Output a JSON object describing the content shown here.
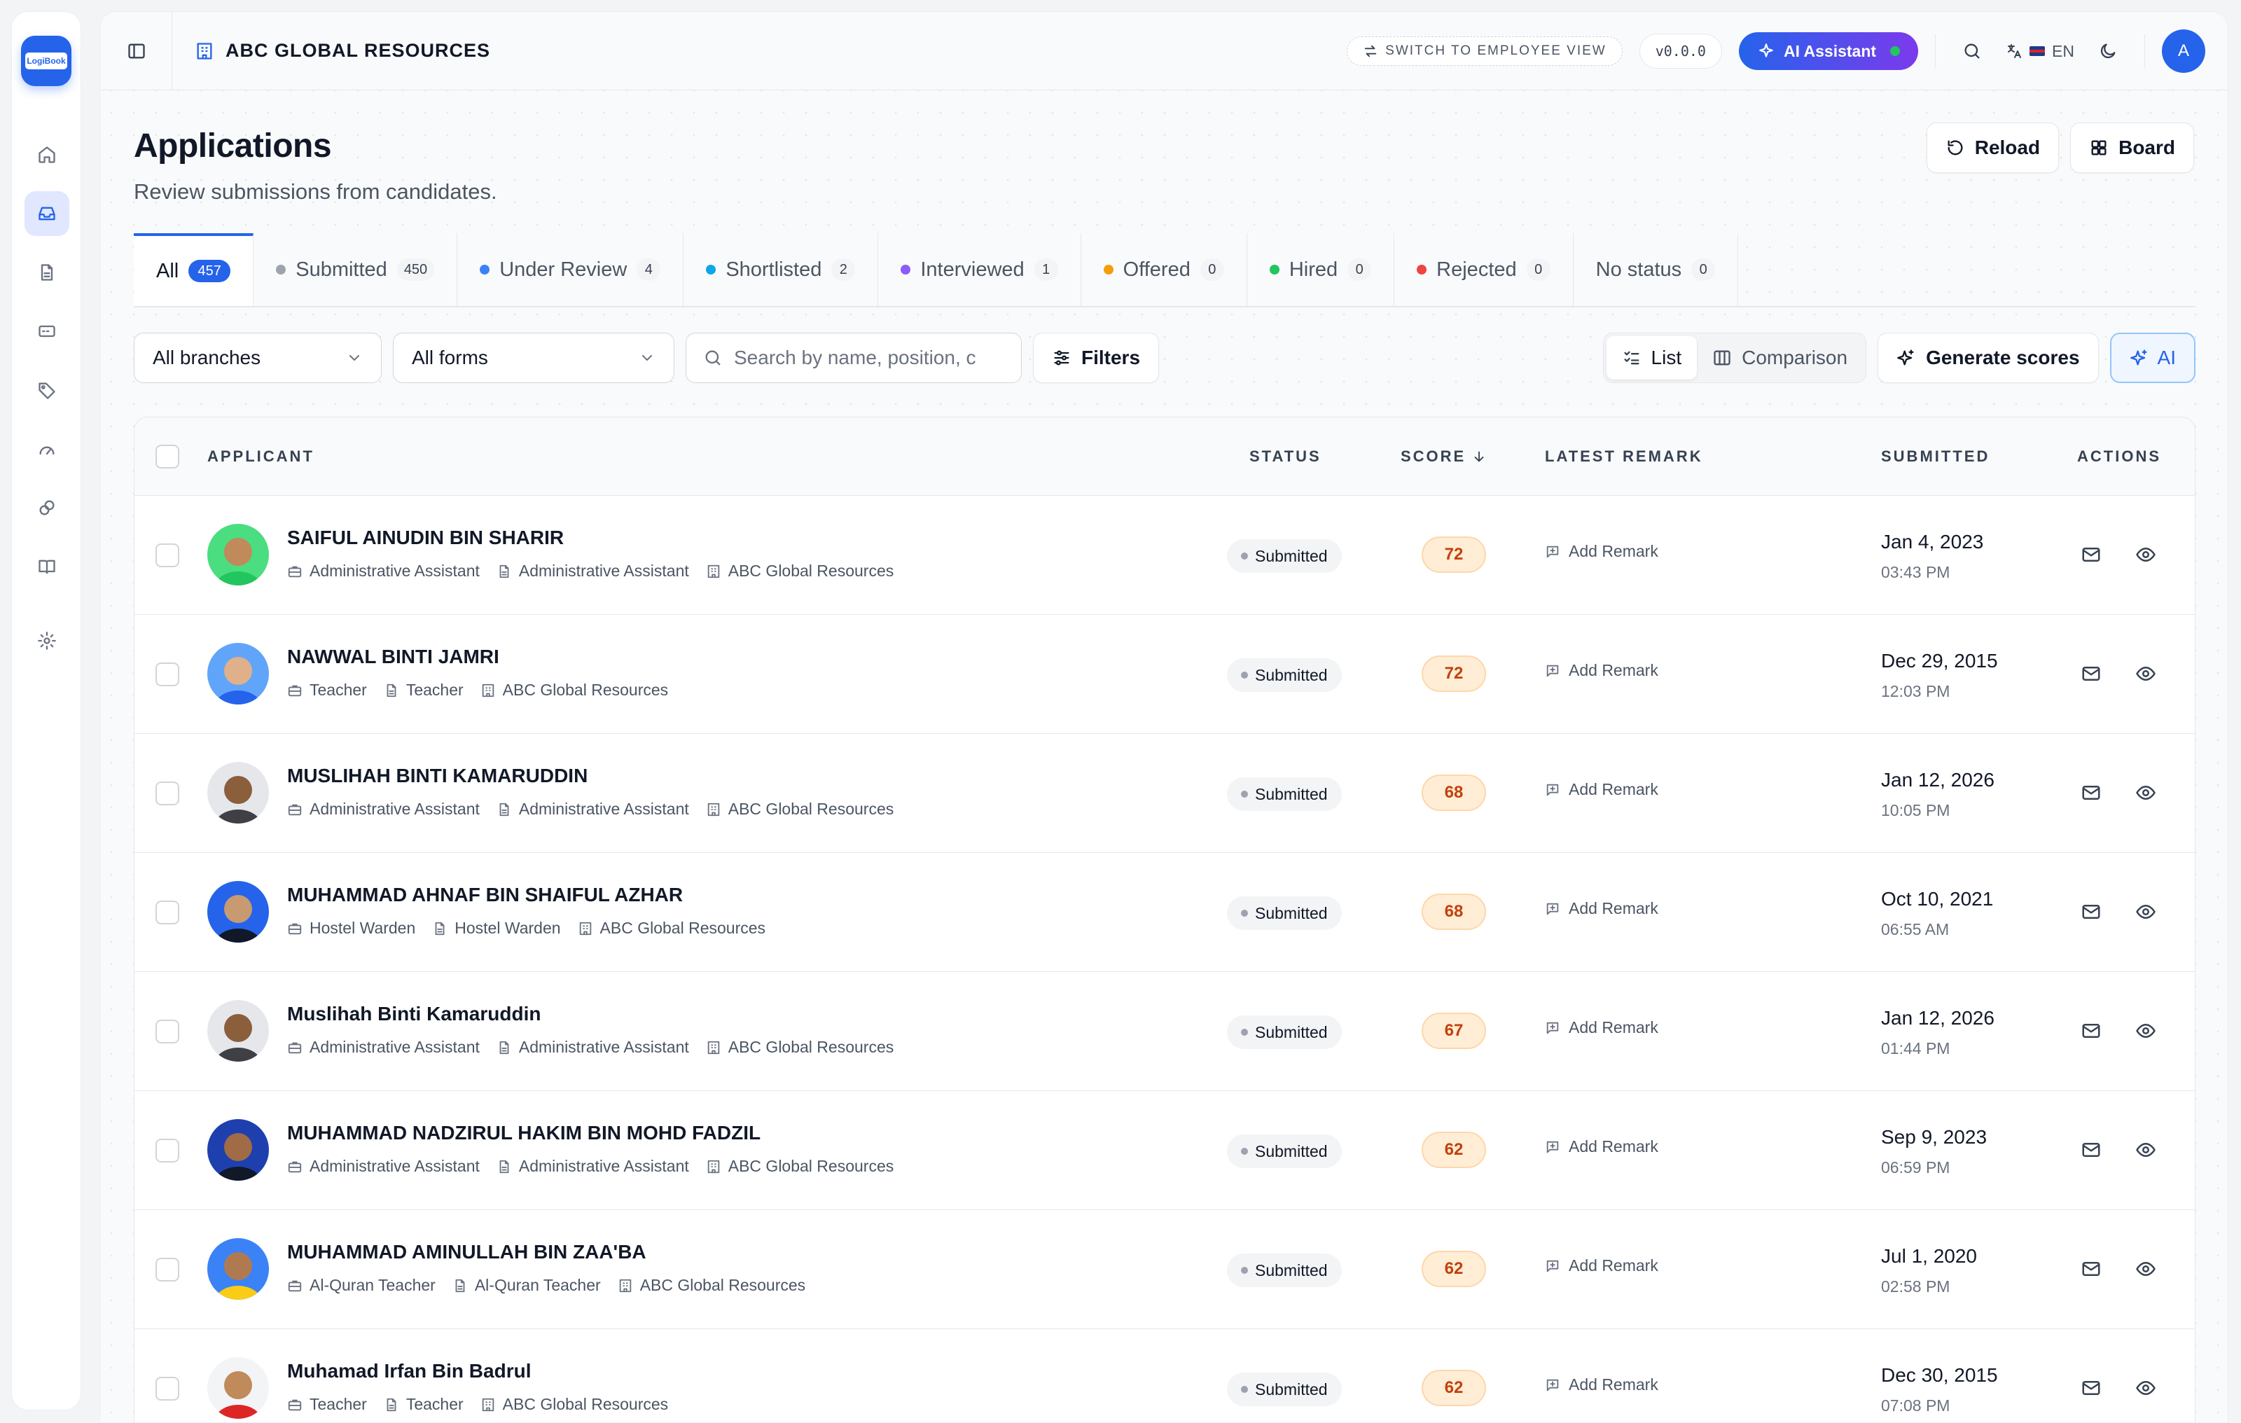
{
  "app": {
    "logo_text": "LogiBook"
  },
  "topbar": {
    "org_name": "ABC GLOBAL RESOURCES",
    "switch_label": "SWITCH TO EMPLOYEE VIEW",
    "version": "v0.0.0",
    "ai_assistant_label": "AI Assistant",
    "language": "EN",
    "avatar_initial": "A"
  },
  "page": {
    "title": "Applications",
    "subtitle": "Review submissions from candidates.",
    "reload_label": "Reload",
    "board_label": "Board"
  },
  "tabs": [
    {
      "label": "All",
      "count": "457",
      "color": ""
    },
    {
      "label": "Submitted",
      "count": "450",
      "color": "#9ca3af"
    },
    {
      "label": "Under Review",
      "count": "4",
      "color": "#3b82f6"
    },
    {
      "label": "Shortlisted",
      "count": "2",
      "color": "#0ea5e9"
    },
    {
      "label": "Interviewed",
      "count": "1",
      "color": "#8b5cf6"
    },
    {
      "label": "Offered",
      "count": "0",
      "color": "#f59e0b"
    },
    {
      "label": "Hired",
      "count": "0",
      "color": "#22c55e"
    },
    {
      "label": "Rejected",
      "count": "0",
      "color": "#ef4444"
    },
    {
      "label": "No status",
      "count": "0",
      "color": ""
    }
  ],
  "filters": {
    "branch": "All branches",
    "form": "All forms",
    "search_placeholder": "Search by name, position, c",
    "filters_label": "Filters",
    "list_label": "List",
    "comparison_label": "Comparison",
    "generate_label": "Generate scores",
    "ai_label": "AI"
  },
  "table": {
    "headers": {
      "applicant": "APPLICANT",
      "status": "STATUS",
      "score": "SCORE",
      "remark": "LATEST REMARK",
      "submitted": "SUBMITTED",
      "actions": "ACTIONS"
    },
    "rows": [
      {
        "name": "SAIFUL AINUDIN BIN SHARIR",
        "position": "Administrative Assistant",
        "form": "Administrative Assistant",
        "branch": "ABC Global Resources",
        "status": "Submitted",
        "score": "72",
        "remark": "Add Remark",
        "date": "Jan 4, 2023",
        "time": "03:43 PM",
        "photo_bg": "#4ade80",
        "skin": "#c08a5b",
        "cloth": "#22c55e"
      },
      {
        "name": "NAWWAL BINTI JAMRI",
        "position": "Teacher",
        "form": "Teacher",
        "branch": "ABC Global Resources",
        "status": "Submitted",
        "score": "72",
        "remark": "Add Remark",
        "date": "Dec 29, 2015",
        "time": "12:03 PM",
        "photo_bg": "#60a5fa",
        "skin": "#e0b08a",
        "cloth": "#2563eb"
      },
      {
        "name": "MUSLIHAH BINTI KAMARUDDIN",
        "position": "Administrative Assistant",
        "form": "Administrative Assistant",
        "branch": "ABC Global Resources",
        "status": "Submitted",
        "score": "68",
        "remark": "Add Remark",
        "date": "Jan 12, 2026",
        "time": "10:05 PM",
        "photo_bg": "#e5e7eb",
        "skin": "#8b5e3c",
        "cloth": "#3f3f46"
      },
      {
        "name": "MUHAMMAD AHNAF BIN SHAIFUL AZHAR",
        "position": "Hostel Warden",
        "form": "Hostel Warden",
        "branch": "ABC Global Resources",
        "status": "Submitted",
        "score": "68",
        "remark": "Add Remark",
        "date": "Oct 10, 2021",
        "time": "06:55 AM",
        "photo_bg": "#2563eb",
        "skin": "#c79a72",
        "cloth": "#111827"
      },
      {
        "name": "Muslihah Binti Kamaruddin",
        "position": "Administrative Assistant",
        "form": "Administrative Assistant",
        "branch": "ABC Global Resources",
        "status": "Submitted",
        "score": "67",
        "remark": "Add Remark",
        "date": "Jan 12, 2026",
        "time": "01:44 PM",
        "photo_bg": "#e5e7eb",
        "skin": "#8b5e3c",
        "cloth": "#3f3f46"
      },
      {
        "name": "MUHAMMAD NADZIRUL HAKIM BIN MOHD FADZIL",
        "position": "Administrative Assistant",
        "form": "Administrative Assistant",
        "branch": "ABC Global Resources",
        "status": "Submitted",
        "score": "62",
        "remark": "Add Remark",
        "date": "Sep 9, 2023",
        "time": "06:59 PM",
        "photo_bg": "#1e40af",
        "skin": "#a06b45",
        "cloth": "#111827"
      },
      {
        "name": "MUHAMMAD AMINULLAH BIN ZAA'BA",
        "position": "Al-Quran Teacher",
        "form": "Al-Quran Teacher",
        "branch": "ABC Global Resources",
        "status": "Submitted",
        "score": "62",
        "remark": "Add Remark",
        "date": "Jul 1, 2020",
        "time": "02:58 PM",
        "photo_bg": "#3b82f6",
        "skin": "#b07a50",
        "cloth": "#facc15"
      },
      {
        "name": "Muhamad Irfan Bin Badrul",
        "position": "Teacher",
        "form": "Teacher",
        "branch": "ABC Global Resources",
        "status": "Submitted",
        "score": "62",
        "remark": "Add Remark",
        "date": "Dec 30, 2015",
        "time": "07:08 PM",
        "photo_bg": "#f3f4f6",
        "skin": "#c08a5b",
        "cloth": "#dc2626"
      }
    ]
  }
}
